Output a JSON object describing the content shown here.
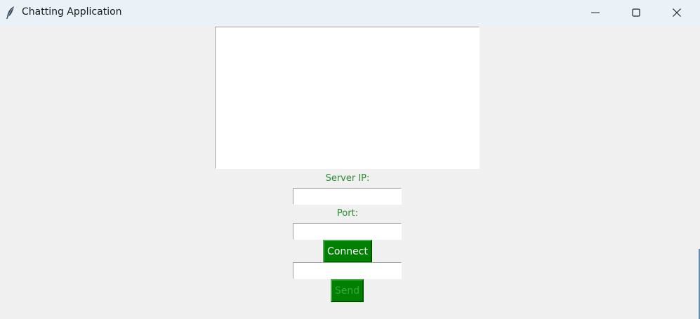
{
  "window": {
    "title": "Chatting Application",
    "app_icon": "feather-icon",
    "controls": {
      "minimize": "minimize-icon",
      "maximize": "maximize-icon",
      "close": "close-icon"
    }
  },
  "chat": {
    "messages_text": ""
  },
  "server_ip": {
    "label": "Server IP:",
    "value": ""
  },
  "port": {
    "label": "Port:",
    "value": ""
  },
  "connect_button": {
    "label": "Connect",
    "enabled": true
  },
  "message_input": {
    "value": ""
  },
  "send_button": {
    "label": "Send",
    "enabled": false
  },
  "colors": {
    "accent_green": "#008000",
    "label_green": "#2e8b2e",
    "disabled_text": "#3aa83a",
    "background": "#f0f0f0",
    "titlebar": "#eaf2f7"
  }
}
